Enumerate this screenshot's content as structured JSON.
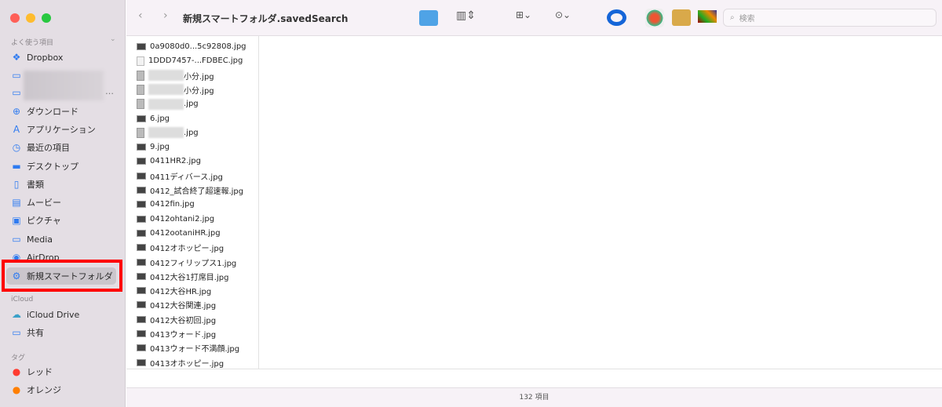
{
  "window": {
    "title": "新規スマートフォルダ.savedSearch",
    "status": "132 項目"
  },
  "search": {
    "placeholder": "検索"
  },
  "sidebar": {
    "favorites_header": "よく使う項目",
    "favorites": [
      {
        "label": "Dropbox",
        "icon": "dropbox-icon"
      },
      {
        "label": "ダウンロード",
        "icon": "download-icon"
      },
      {
        "label": "アプリケーション",
        "icon": "applications-icon"
      },
      {
        "label": "最近の項目",
        "icon": "clock-icon"
      },
      {
        "label": "デスクトップ",
        "icon": "desktop-icon"
      },
      {
        "label": "書類",
        "icon": "document-icon"
      },
      {
        "label": "ムービー",
        "icon": "movie-icon"
      },
      {
        "label": "ピクチャ",
        "icon": "picture-icon"
      },
      {
        "label": "Media",
        "icon": "folder-icon"
      },
      {
        "label": "AirDrop",
        "icon": "airdrop-icon"
      },
      {
        "label": "新規スマートフォルダ",
        "icon": "gear-icon"
      }
    ],
    "icloud_header": "iCloud",
    "icloud": [
      {
        "label": "iCloud Drive"
      },
      {
        "label": "共有"
      }
    ],
    "tags_header": "タグ",
    "tags": [
      {
        "label": "レッド",
        "color": "#ff3b30"
      },
      {
        "label": "オレンジ",
        "color": "#ff7f00"
      }
    ]
  },
  "files": [
    "0a9080d0...5c92808.jpg",
    "1DDD7457-...FDBEC.jpg",
    "小分.jpg",
    "小分.jpg",
    ".jpg",
    "6.jpg",
    ".jpg",
    "9.jpg",
    "0411HR2.jpg",
    "0411ディバース.jpg",
    "0412_試合終了超速報.jpg",
    "0412fin.jpg",
    "0412ohtani2.jpg",
    "0412ootaniHR.jpg",
    "0412オホッピー.jpg",
    "0412フィリップス1.jpg",
    "0412大谷1打席目.jpg",
    "0412大谷HR.jpg",
    "0412大谷関連.jpg",
    "0412大谷初回.jpg",
    "0413ウォード.jpg",
    "0413ウォード不満顔.jpg",
    "0413オホッピー.jpg"
  ]
}
